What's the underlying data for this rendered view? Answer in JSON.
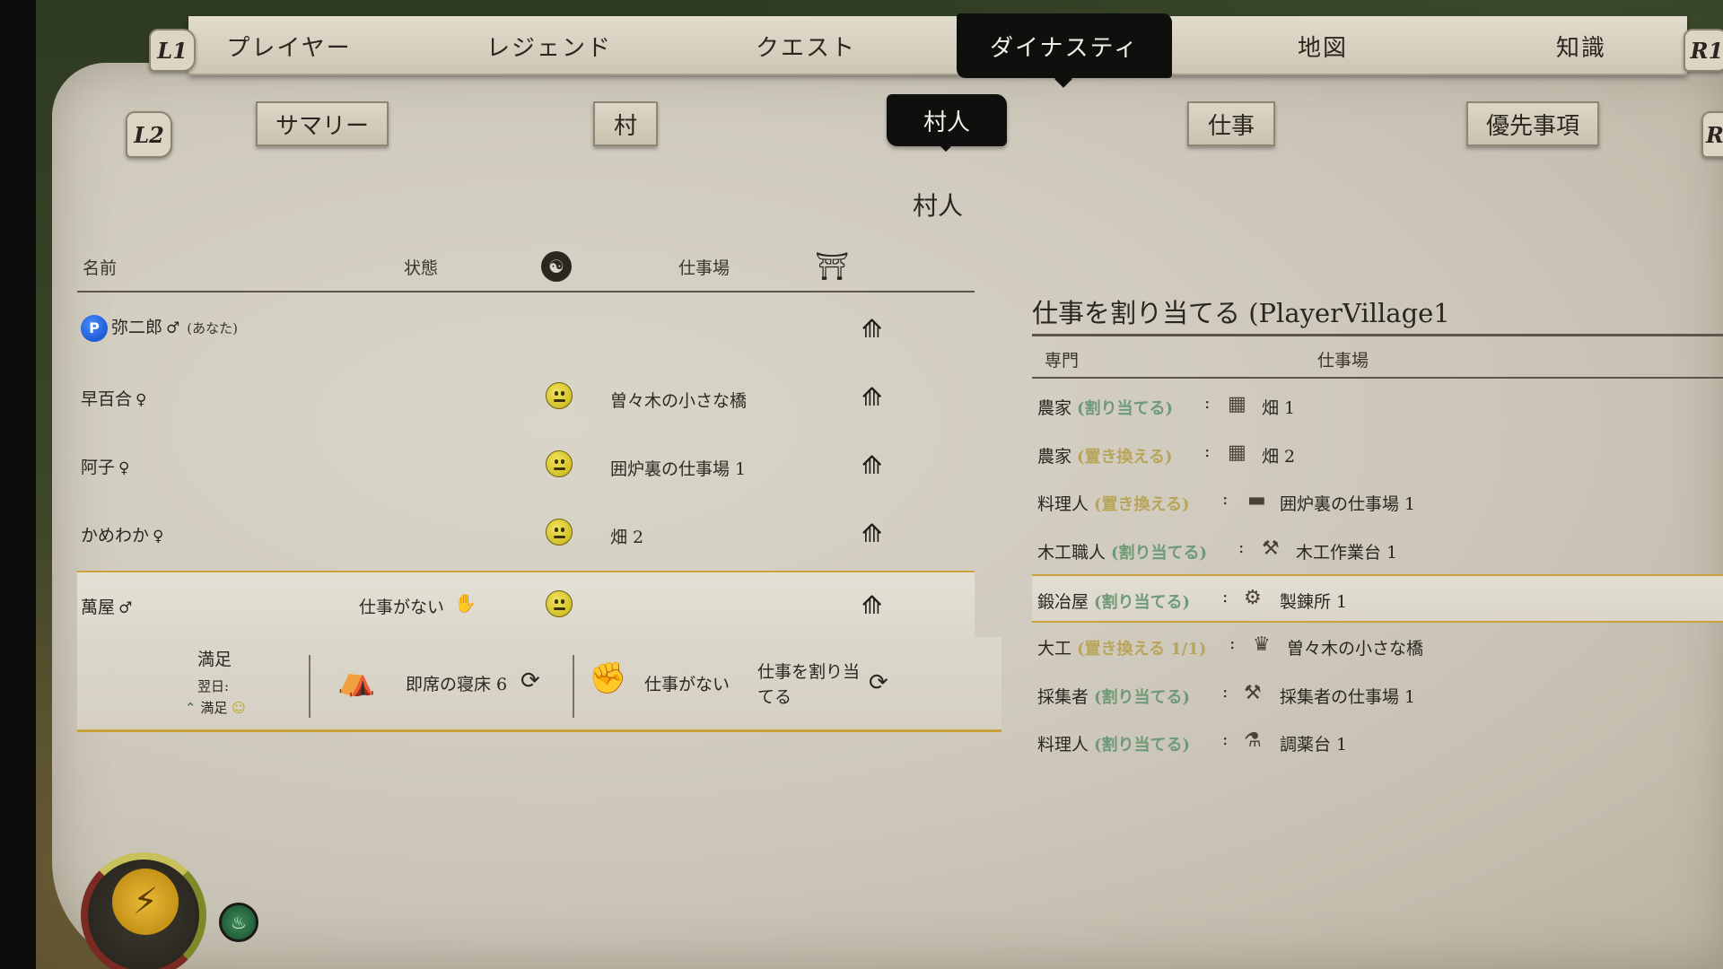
{
  "nav": {
    "left_button": "L1",
    "right_button": "R1",
    "tabs": [
      "プレイヤー",
      "レジェンド",
      "クエスト",
      "ダイナスティ",
      "地図",
      "知識"
    ],
    "active_tab": "ダイナスティ"
  },
  "subnav": {
    "left_button": "L2",
    "right_button": "R",
    "tabs": [
      "サマリー",
      "村",
      "村人",
      "仕事",
      "優先事項"
    ],
    "active_tab": "村人"
  },
  "page_title": "村人",
  "villagers": {
    "headers": {
      "name": "名前",
      "status": "状態",
      "workplace": "仕事場"
    },
    "rows": [
      {
        "name": "弥二郎",
        "gender": "♂",
        "you": "(あなた)",
        "status": "",
        "workplace": ""
      },
      {
        "name": "早百合",
        "gender": "♀",
        "status": "",
        "workplace": "曽々木の小さな橋"
      },
      {
        "name": "阿子",
        "gender": "♀",
        "status": "",
        "workplace": "囲炉裏の仕事場 1"
      },
      {
        "name": "かめわか",
        "gender": "♀",
        "status": "",
        "workplace": "畑 2"
      },
      {
        "name": "萬屋",
        "gender": "♂",
        "status": "仕事がない",
        "workplace": ""
      }
    ]
  },
  "detail": {
    "mood_title": "満足",
    "next_day_label": "翌日:",
    "next_day_mood": "満足",
    "bed": "即席の寝床 6",
    "job_status": "仕事がない",
    "assign_line1": "仕事を割り当",
    "assign_line2": "てる"
  },
  "assign_panel": {
    "title": "仕事を割り当てる (PlayerVillage1",
    "headers": {
      "specialty": "専門",
      "workplace": "仕事場"
    },
    "rows": [
      {
        "specialty": "農家",
        "action": "(割り当てる)",
        "action_type": "assign",
        "workplace": "畑 1"
      },
      {
        "specialty": "農家",
        "action": "(置き換える)",
        "action_type": "replace",
        "workplace": "畑 2"
      },
      {
        "specialty": "料理人",
        "action": "(置き換える)",
        "action_type": "replace",
        "workplace": "囲炉裏の仕事場 1"
      },
      {
        "specialty": "木工職人",
        "action": "(割り当てる)",
        "action_type": "assign",
        "workplace": "木工作業台 1"
      },
      {
        "specialty": "鍛冶屋",
        "action": "(割り当てる)",
        "action_type": "assign",
        "workplace": "製錬所 1"
      },
      {
        "specialty": "大工",
        "action": "(置き換える 1/1)",
        "action_type": "replace",
        "workplace": "曽々木の小さな橋"
      },
      {
        "specialty": "採集者",
        "action": "(割り当てる)",
        "action_type": "assign",
        "workplace": "採集者の仕事場 1"
      },
      {
        "specialty": "料理人",
        "action": "(割り当てる)",
        "action_type": "assign",
        "workplace": "調薬台 1"
      }
    ]
  },
  "colors": {
    "accent_gold": "#c9a23a",
    "assign_green": "#6f9a78",
    "replace_yellow": "#b9a55a",
    "tab_active": "#0f0f0e"
  }
}
